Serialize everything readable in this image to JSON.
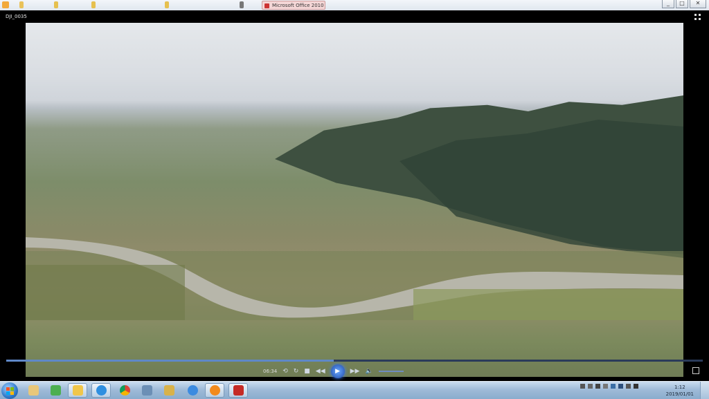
{
  "window": {
    "tab_title": "Microsoft Office 2010",
    "controls": [
      "_",
      "□",
      "✕"
    ]
  },
  "player": {
    "filename": "DJI_0035",
    "time": "06:34",
    "progress_fraction": 0.47
  },
  "taskbar": {
    "clock_time": "1:12",
    "clock_date": "2019/01/01",
    "apps": [
      "explorer-icon",
      "media-center-icon",
      "games-icon",
      "folder-icon",
      "ie-icon",
      "chrome-icon",
      "network-icon",
      "paint-icon",
      "messenger-icon",
      "media-player-icon",
      "acrobat-icon"
    ]
  }
}
